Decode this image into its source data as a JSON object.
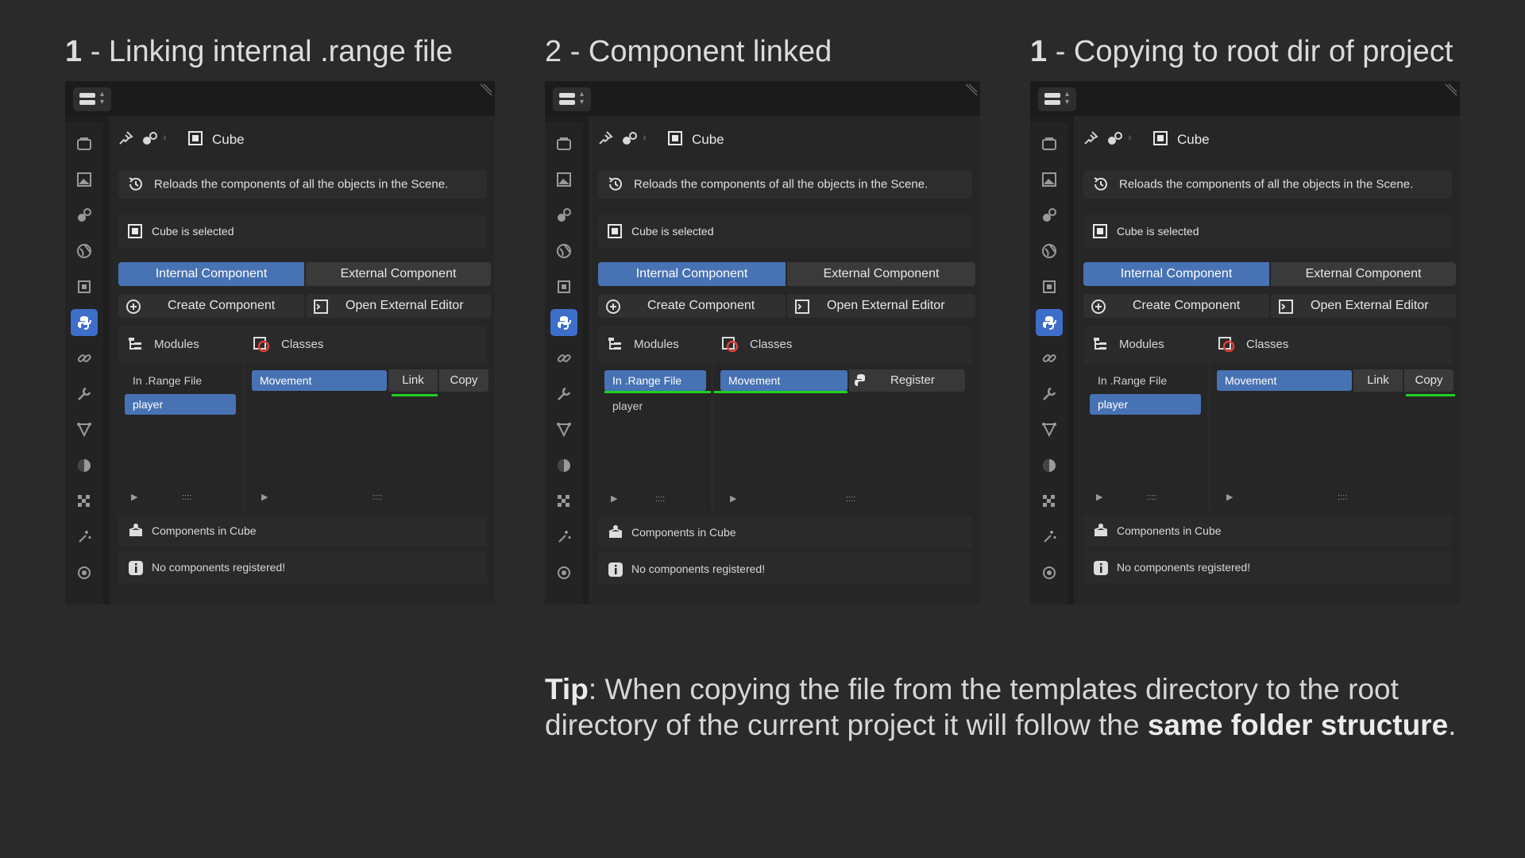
{
  "steps": [
    {
      "number": "1",
      "title": " - Linking internal .range file",
      "object_name": "Cube",
      "reload_text": "Reloads the components of all the objects in the Scene.",
      "selected_text": "Cube is selected",
      "tab_internal": "Internal Component",
      "tab_external": "External Component",
      "create_label": "Create Component",
      "open_editor_label": "Open External Editor",
      "modules_label": "Modules",
      "classes_label": "Classes",
      "modules_items": [
        "In .Range File",
        "player"
      ],
      "classes_items": [
        "Movement"
      ],
      "action_a": "Link",
      "action_b": "Copy",
      "components_label": "Components in Cube",
      "no_components": "No components registered!"
    },
    {
      "number": "2",
      "title": " - Component linked",
      "object_name": "Cube",
      "reload_text": "Reloads the components of all the objects in the Scene.",
      "selected_text": "Cube is selected",
      "tab_internal": "Internal Component",
      "tab_external": "External Component",
      "create_label": "Create Component",
      "open_editor_label": "Open External Editor",
      "modules_label": "Modules",
      "classes_label": "Classes",
      "modules_items": [
        "In .Range File",
        "player"
      ],
      "classes_items": [
        "Movement"
      ],
      "action_a": "Register",
      "components_label": "Components in Cube",
      "no_components": "No components registered!"
    },
    {
      "number": "1",
      "title": " - Copying to root dir of project",
      "object_name": "Cube",
      "reload_text": "Reloads the components of all the objects in the Scene.",
      "selected_text": "Cube is selected",
      "tab_internal": "Internal Component",
      "tab_external": "External Component",
      "create_label": "Create Component",
      "open_editor_label": "Open External Editor",
      "modules_label": "Modules",
      "classes_label": "Classes",
      "modules_items": [
        "In .Range File",
        "player"
      ],
      "classes_items": [
        "Movement"
      ],
      "action_a": "Link",
      "action_b": "Copy",
      "components_label": "Components in Cube",
      "no_components": "No components registered!"
    }
  ],
  "tip": {
    "lead": "Tip",
    "text_1": ": When copying the file from the templates directory to the root directory of the current project it will follow the ",
    "emphasis": "same folder structure",
    "text_2": "."
  },
  "colors": {
    "accent": "#4772b3",
    "highlight": "#21d11f",
    "background": "#2a2a2a"
  }
}
